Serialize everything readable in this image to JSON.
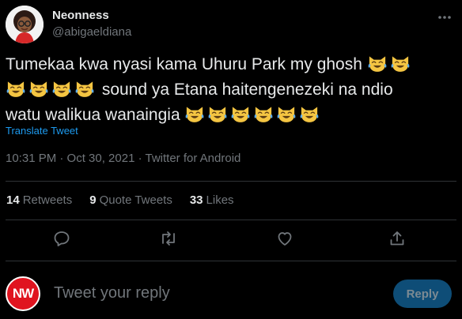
{
  "user": {
    "display_name": "Neonness",
    "handle": "@abigaeldiana"
  },
  "tweet": {
    "text_line1": "Tumekaa kwa nyasi kama Uhuru Park my ghosh",
    "text_line2_after_emojis": "sound ya Etana haitengenezeki na ndio",
    "text_line3": "watu walikua wanaingia",
    "emoji_name": "face-with-tears-of-joy-cat",
    "emoji_counts": {
      "line1": 2,
      "line2": 4,
      "line3": 6
    },
    "translate_label": "Translate Tweet",
    "timestamp": "10:31 PM · Oct 30, 2021 · Twitter for Android"
  },
  "stats": {
    "retweets_count": "14",
    "retweets_label": "Retweets",
    "quote_count": "9",
    "quote_label": "Quote Tweets",
    "likes_count": "33",
    "likes_label": "Likes"
  },
  "reply_box": {
    "avatar_text": "NW",
    "placeholder": "Tweet your reply",
    "button_label": "Reply"
  },
  "colors": {
    "background": "#000000",
    "text": "#e7e9ea",
    "muted": "#71767b",
    "accent": "#1d9bf0",
    "divider": "#2f3336"
  }
}
